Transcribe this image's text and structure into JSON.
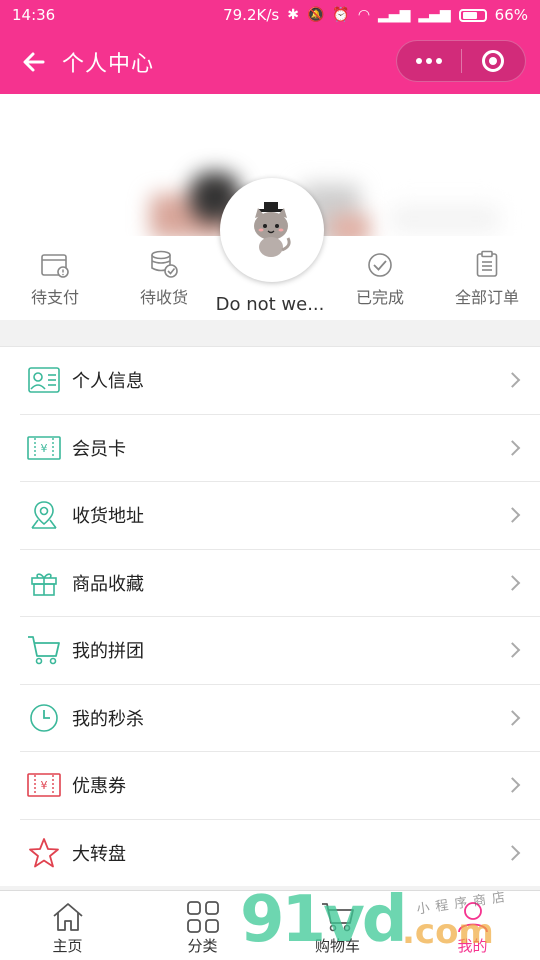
{
  "status_bar": {
    "time": "14:36",
    "speed": "79.2K/s",
    "battery": "66%"
  },
  "nav": {
    "title": "个人中心"
  },
  "profile": {
    "nickname": "Do not we..."
  },
  "orders": [
    {
      "label": "待支付",
      "icon": "pending-payment-icon"
    },
    {
      "label": "待收货",
      "icon": "pending-receipt-icon"
    },
    {
      "label": "已完成",
      "icon": "completed-icon"
    },
    {
      "label": "全部订单",
      "icon": "all-orders-icon"
    }
  ],
  "menu": [
    {
      "label": "个人信息",
      "icon": "profile-card-icon"
    },
    {
      "label": "会员卡",
      "icon": "membership-card-icon"
    },
    {
      "label": "收货地址",
      "icon": "location-icon"
    },
    {
      "label": "商品收藏",
      "icon": "gift-icon"
    },
    {
      "label": "我的拼团",
      "icon": "cart-icon"
    },
    {
      "label": "我的秒杀",
      "icon": "clock-icon"
    },
    {
      "label": "优惠券",
      "icon": "coupon-icon"
    },
    {
      "label": "大转盘",
      "icon": "star-icon"
    }
  ],
  "tabs": [
    {
      "label": "主页",
      "icon": "home-icon"
    },
    {
      "label": "分类",
      "icon": "grid-icon"
    },
    {
      "label": "购物车",
      "icon": "cart-icon"
    },
    {
      "label": "我的",
      "icon": "person-icon",
      "active": true
    }
  ],
  "watermark": {
    "brand": "91vd",
    "suffix": ".com",
    "tagline": "小程序商店"
  },
  "colors": {
    "brand_pink": "#f5338f",
    "teal": "#3bb89a",
    "red": "#e0424f"
  }
}
